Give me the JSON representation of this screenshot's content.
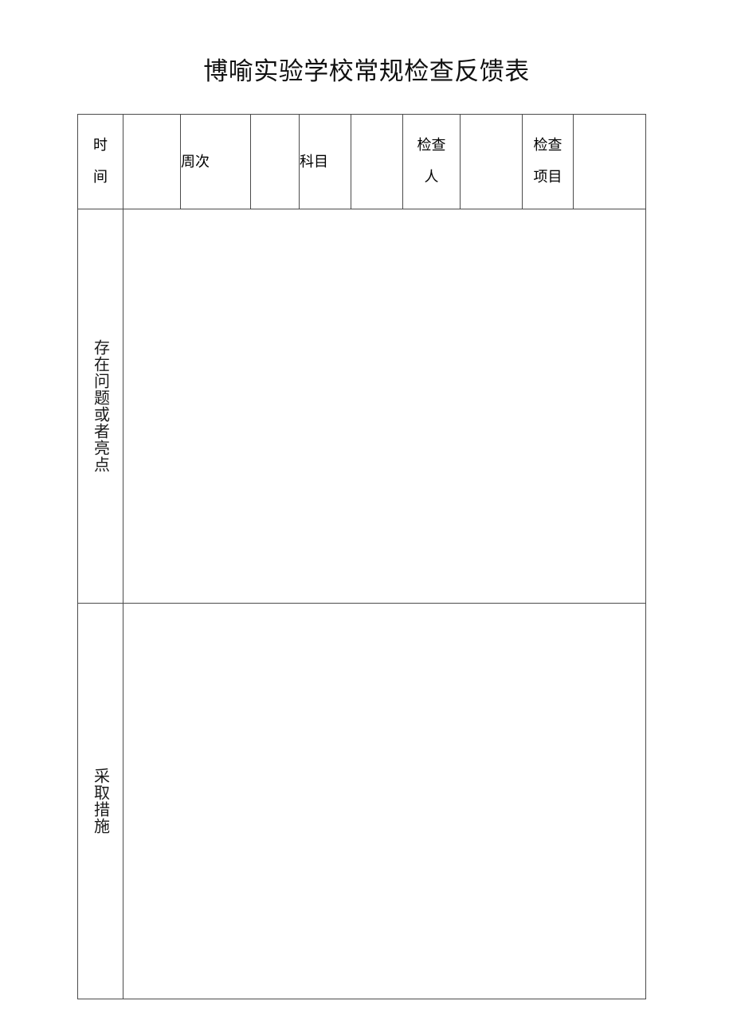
{
  "document": {
    "title": "博喻实验学校常规检查反馈表"
  },
  "table": {
    "header_row": [
      {
        "label": "时间",
        "type": "label",
        "stacked": true,
        "lines": [
          "时",
          "间"
        ]
      },
      {
        "label": "",
        "type": "blank"
      },
      {
        "label": "周次",
        "type": "label",
        "stacked": false,
        "lines": [
          "周次"
        ]
      },
      {
        "label": "",
        "type": "blank"
      },
      {
        "label": "科目",
        "type": "label",
        "stacked": false,
        "lines": [
          "科目"
        ]
      },
      {
        "label": "",
        "type": "blank"
      },
      {
        "label": "检查人",
        "type": "label",
        "stacked": true,
        "lines": [
          "检查",
          "人"
        ]
      },
      {
        "label": "",
        "type": "blank"
      },
      {
        "label": "检查项目",
        "type": "label",
        "stacked": true,
        "lines": [
          "检查",
          "项目"
        ]
      },
      {
        "label": "",
        "type": "blank"
      }
    ],
    "body_rows": [
      {
        "label": "存在问题或者亮点",
        "content": ""
      },
      {
        "label": "采取措施",
        "content": ""
      }
    ]
  }
}
